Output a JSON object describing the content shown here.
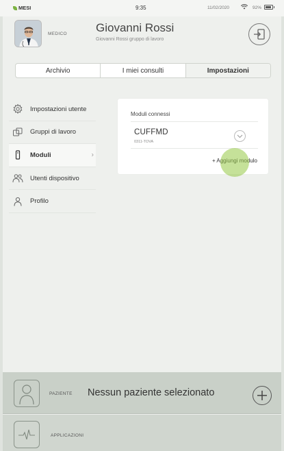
{
  "status_bar": {
    "carrier": "MESI",
    "time": "9:35",
    "date": "11/02/2020",
    "battery": "92%"
  },
  "header": {
    "role": "MEDICO",
    "user_name": "Giovanni Rossi",
    "user_group": "Giovanni Rossi gruppo di lavoro"
  },
  "tabs": [
    {
      "label": "Archivio",
      "active": false
    },
    {
      "label": "I miei consulti",
      "active": false
    },
    {
      "label": "Impostazioni",
      "active": true
    }
  ],
  "sidebar": {
    "items": [
      {
        "label": "Impostazioni utente",
        "icon": "gear-icon",
        "active": false
      },
      {
        "label": "Gruppi di lavoro",
        "icon": "groups-icon",
        "active": false
      },
      {
        "label": "Moduli",
        "icon": "module-icon",
        "active": true
      },
      {
        "label": "Utenti dispositivo",
        "icon": "users-icon",
        "active": false
      },
      {
        "label": "Profilo",
        "icon": "profile-icon",
        "active": false
      }
    ]
  },
  "modules": {
    "title": "Moduli connessi",
    "items": [
      {
        "name": "CUFFMD",
        "code": "0311-TOVA"
      }
    ],
    "add_label": "+ Aggiungi modulo"
  },
  "patient": {
    "role": "PAZIENTE",
    "name": "Nessun paziente selezionato"
  },
  "applications": {
    "role": "APPLICAZIONI"
  },
  "colors": {
    "accent": "#7cb342",
    "background": "#eef0ed",
    "footer": "#c9d0c8"
  }
}
